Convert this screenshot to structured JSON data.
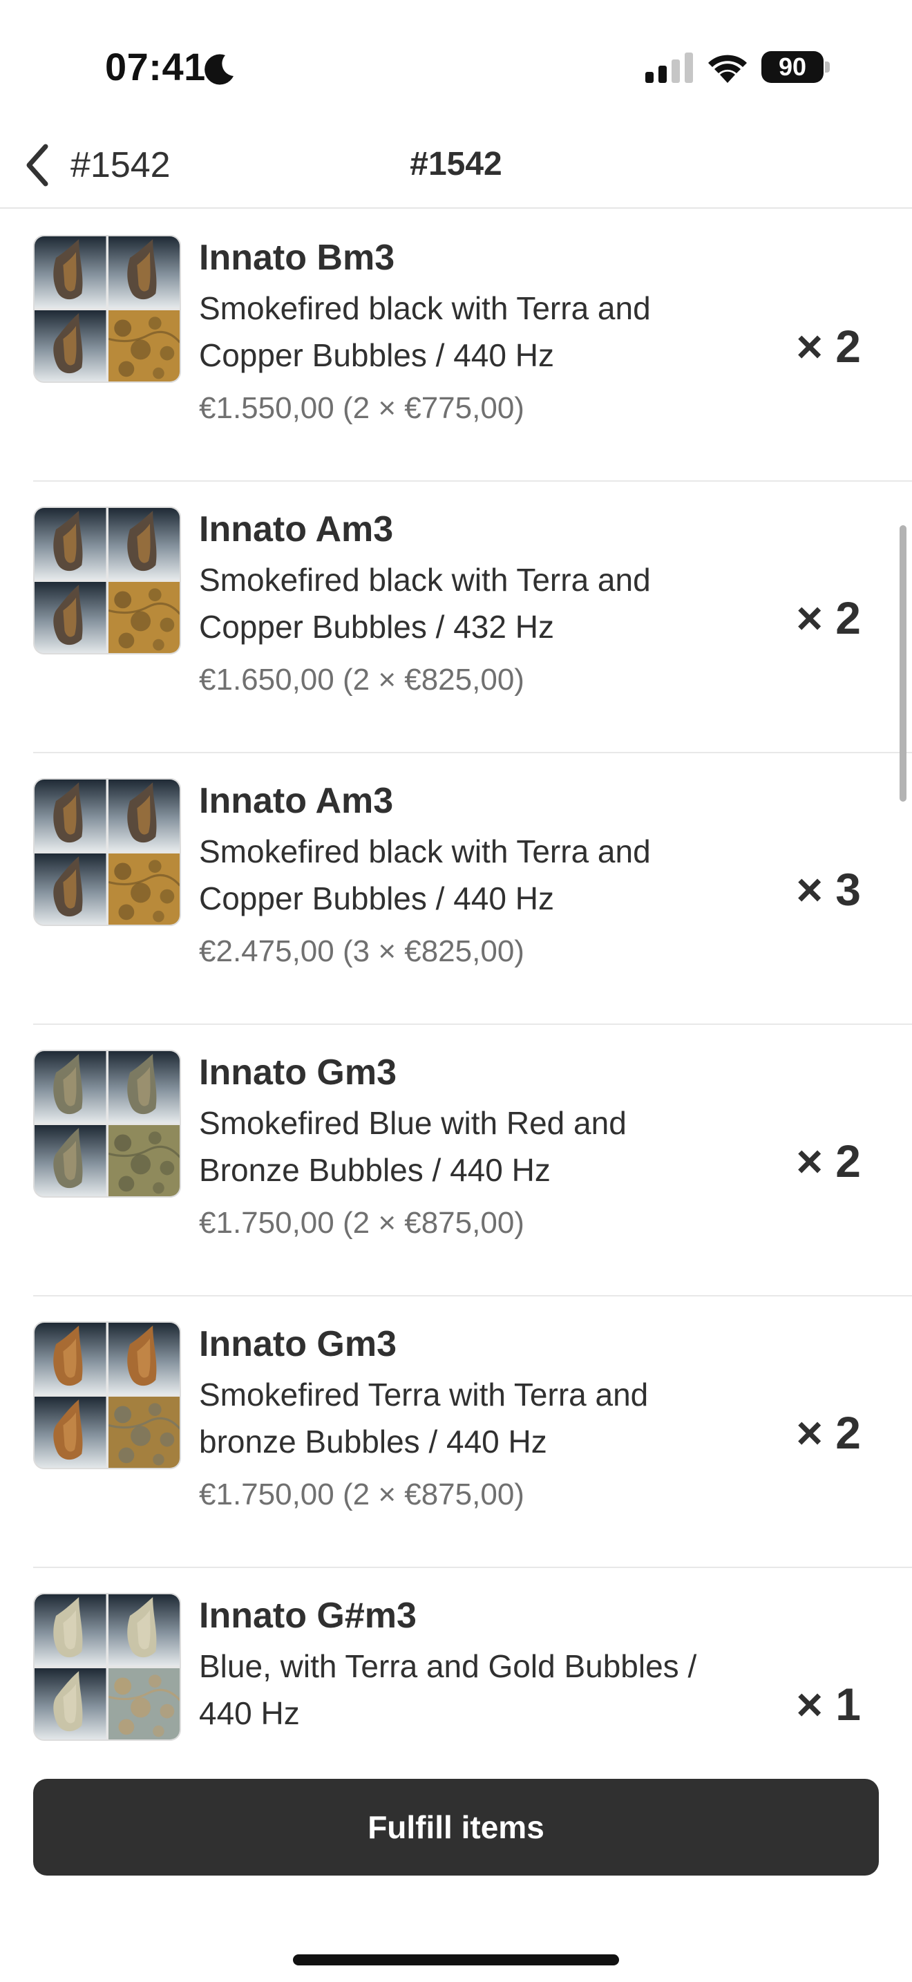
{
  "status_bar": {
    "time": "07:41",
    "moon_icon": "moon-icon",
    "signal_icon": "cellular-signal-icon",
    "wifi_icon": "wifi-icon",
    "battery_level": "90"
  },
  "nav": {
    "back_icon": "chevron-left-icon",
    "back_label": "#1542",
    "title": "#1542"
  },
  "items": [
    {
      "title": "Innato Bm3",
      "variant_line1": "Smokefired black with Terra and",
      "variant_line2": "Copper Bubbles / 440 Hz",
      "price": "€1.550,00 (2 × €775,00)",
      "qty": "× 2",
      "palette": "black-terra"
    },
    {
      "title": "Innato Am3",
      "variant_line1": "Smokefired black with Terra and",
      "variant_line2": "Copper Bubbles / 432 Hz",
      "price": "€1.650,00 (2 × €825,00)",
      "qty": "× 2",
      "palette": "black-terra"
    },
    {
      "title": "Innato Am3",
      "variant_line1": "Smokefired black with Terra and",
      "variant_line2": "Copper Bubbles / 440 Hz",
      "price": "€2.475,00 (3 × €825,00)",
      "qty": "× 3",
      "palette": "black-terra"
    },
    {
      "title": "Innato Gm3",
      "variant_line1": "Smokefired Blue with Red and",
      "variant_line2": "Bronze Bubbles / 440 Hz",
      "price": "€1.750,00 (2 × €875,00)",
      "qty": "× 2",
      "palette": "blue-bronze"
    },
    {
      "title": "Innato Gm3",
      "variant_line1": "Smokefired Terra with Terra and",
      "variant_line2": "bronze Bubbles / 440 Hz",
      "price": "€1.750,00 (2 × €875,00)",
      "qty": "× 2",
      "palette": "terra"
    },
    {
      "title": "Innato G#m3",
      "variant_line1": "Blue, with Terra and Gold Bubbles /",
      "variant_line2": "440 Hz",
      "price": "",
      "qty": "× 1",
      "palette": "blue-gold"
    }
  ],
  "palettes": {
    "black-terra": {
      "flute": "#5a4a3c",
      "accent": "#c58a3e",
      "texture_base": "#b98a3a",
      "texture_spot": "#5b4420"
    },
    "blue-bronze": {
      "flute": "#7c7a62",
      "accent": "#b3a27a",
      "texture_base": "#8f8a5c",
      "texture_spot": "#4e4d3a"
    },
    "terra": {
      "flute": "#a86b33",
      "accent": "#d59a55",
      "texture_base": "#a4803f",
      "texture_spot": "#5f6f78"
    },
    "blue-gold": {
      "flute": "#c9c4a8",
      "accent": "#e2dcc2",
      "texture_base": "#9aa6a0",
      "texture_spot": "#c79a5a"
    }
  },
  "footer": {
    "fulfill_label": "Fulfill items"
  },
  "colors": {
    "button_bg": "#303030",
    "text_primary": "#303030",
    "text_secondary": "#707070"
  }
}
